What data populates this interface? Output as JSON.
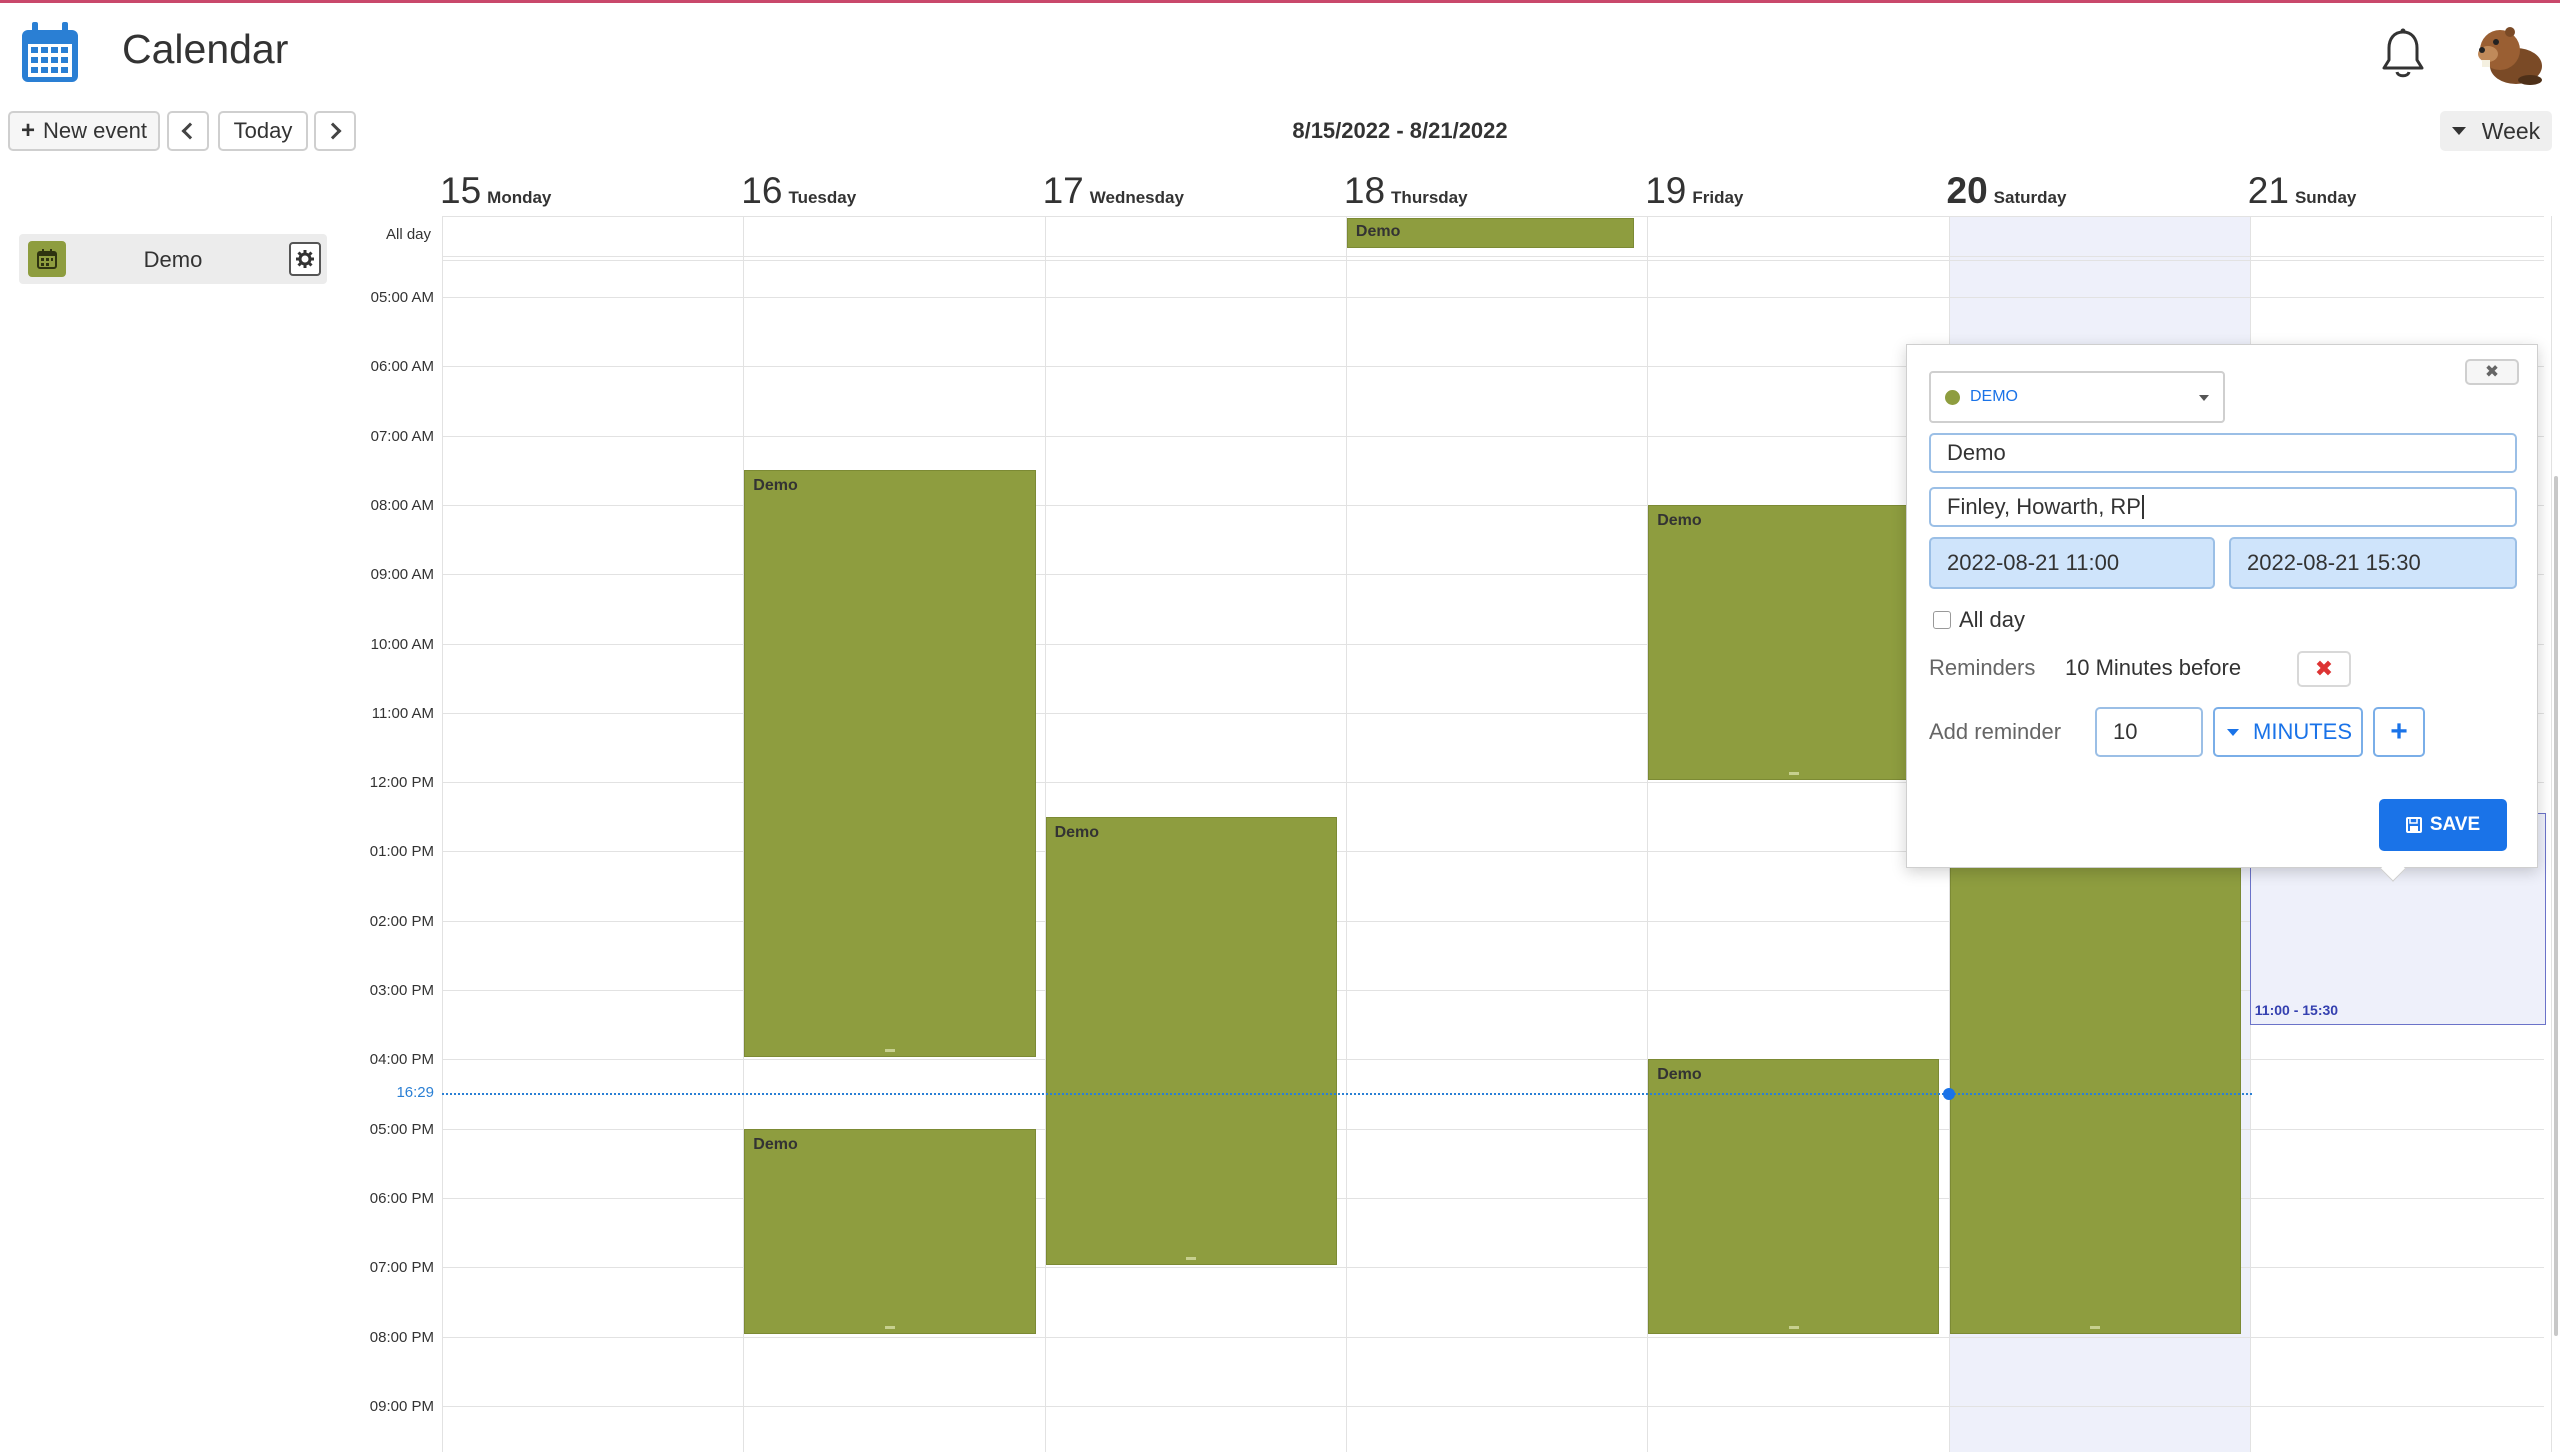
{
  "header": {
    "app_title": "Calendar",
    "icons": {
      "app": "calendar-icon",
      "notifications": "bell-icon",
      "avatar": "beaver-avatar"
    }
  },
  "toolbar": {
    "new_event_label": "New event",
    "today_label": "Today",
    "date_range": "8/15/2022 - 8/21/2022",
    "view_label": "Week"
  },
  "sidebar": {
    "calendars": [
      {
        "label": "Demo",
        "color": "#8e9d3f"
      }
    ]
  },
  "week": {
    "days": [
      {
        "num": "15",
        "name": "Monday"
      },
      {
        "num": "16",
        "name": "Tuesday"
      },
      {
        "num": "17",
        "name": "Wednesday"
      },
      {
        "num": "18",
        "name": "Thursday"
      },
      {
        "num": "19",
        "name": "Friday"
      },
      {
        "num": "20",
        "name": "Saturday"
      },
      {
        "num": "21",
        "name": "Sunday"
      }
    ],
    "allday_label": "All day",
    "times": [
      "05:00 AM",
      "06:00 AM",
      "07:00 AM",
      "08:00 AM",
      "09:00 AM",
      "10:00 AM",
      "11:00 AM",
      "12:00 PM",
      "01:00 PM",
      "02:00 PM",
      "03:00 PM",
      "04:00 PM",
      "05:00 PM",
      "06:00 PM",
      "07:00 PM",
      "08:00 PM",
      "09:00 PM"
    ],
    "now_label": "16:29",
    "allday_events": [
      {
        "day": 3,
        "title": "Demo"
      }
    ],
    "events": [
      {
        "day": 1,
        "title": "Demo",
        "start": 7.5,
        "end": 16.0
      },
      {
        "day": 1,
        "title": "Demo",
        "start": 17.0,
        "end": 20.0
      },
      {
        "day": 2,
        "title": "Demo",
        "start": 12.5,
        "end": 19.0
      },
      {
        "day": 4,
        "title": "Demo",
        "start": 8.0,
        "end": 12.0
      },
      {
        "day": 4,
        "title": "Demo",
        "start": 16.0,
        "end": 20.0
      },
      {
        "day": 5,
        "title": "Demo",
        "start": 8.0,
        "end": 20.0
      }
    ],
    "new_slot_label": "11:00 - 15:30",
    "event_color": "#8e9d3f"
  },
  "popup": {
    "calendar_select": "DEMO",
    "title_value": "Demo",
    "attendees_value": "Finley, Howarth, RP",
    "start_value": "2022-08-21 11:00",
    "end_value": "2022-08-21 15:30",
    "allday_label": "All day",
    "reminders_label": "Reminders",
    "reminder_value": "10 Minutes before",
    "add_reminder_label": "Add reminder",
    "add_reminder_amount": "10",
    "add_reminder_unit": "MINUTES",
    "save_label": "SAVE"
  }
}
